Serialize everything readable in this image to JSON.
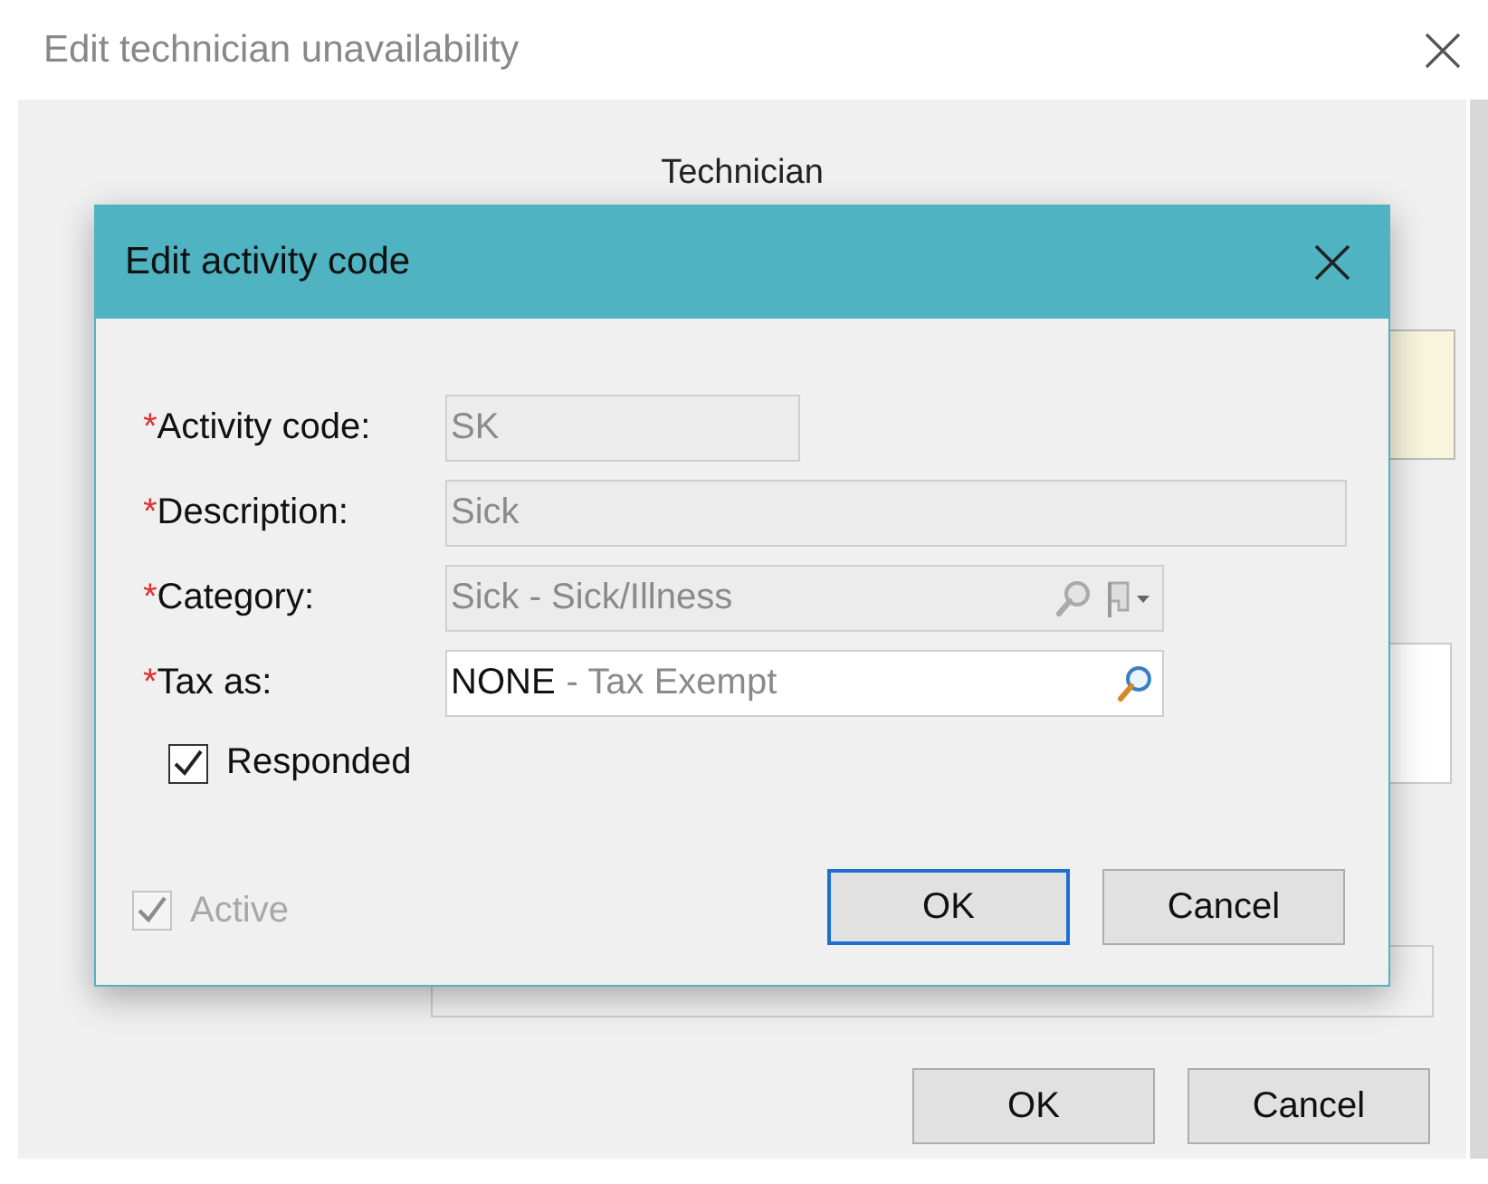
{
  "window": {
    "title": "Edit technician unavailability",
    "section_heading": "Technician",
    "buttons": [
      {
        "label": "OK",
        "default": false
      },
      {
        "label": "Cancel",
        "default": false
      }
    ]
  },
  "dialog": {
    "title": "Edit activity code",
    "fields": [
      {
        "kind": "text",
        "required_mark": "*",
        "label": "Activity code:",
        "readonly": true,
        "value": "SK"
      },
      {
        "kind": "text",
        "required_mark": "*",
        "label": "Description:",
        "readonly": true,
        "value": "Sick"
      },
      {
        "kind": "lookup_menu",
        "required_mark": "*",
        "label": "Category:",
        "readonly": true,
        "value": "Sick - Sick/Illness"
      },
      {
        "kind": "lookup",
        "required_mark": "*",
        "label": "Tax as:",
        "readonly": false,
        "code": "NONE",
        "value": "- Tax Exempt"
      }
    ],
    "checkboxes": [
      {
        "label": "Responded",
        "checked": true,
        "disabled": false
      }
    ],
    "footer_checkbox": {
      "label": "Active",
      "checked": true,
      "disabled": true
    },
    "buttons": [
      {
        "label": "OK",
        "default": true
      },
      {
        "label": "Cancel",
        "default": false
      }
    ]
  }
}
